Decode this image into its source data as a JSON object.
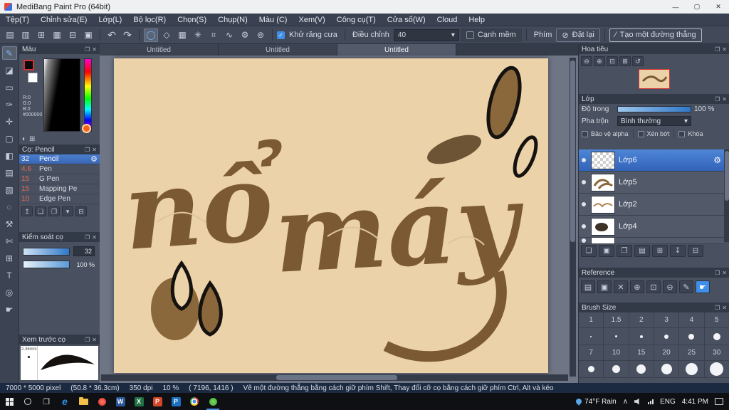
{
  "colors": {
    "accent": "#3f7fd6",
    "canvas": "#ecd2a9",
    "ink": "#7b5a33",
    "selection": "#3a66b4"
  },
  "titlebar": {
    "title": "MediBang Paint Pro (64bit)",
    "minimize": "—",
    "maximize": "▢",
    "close": "✕"
  },
  "menubar": {
    "items": [
      "Tệp(T)",
      "Chỉnh sửa(E)",
      "Lớp(L)",
      "Bộ lọc(R)",
      "Chọn(S)",
      "Chụp(N)",
      "Màu (C)",
      "Xem(V)",
      "Công cụ(T)",
      "Cửa sổ(W)",
      "Cloud",
      "Help"
    ]
  },
  "toolbar": {
    "anti_alias": "Khử răng cưa",
    "adjust_label": "Điều chỉnh",
    "adjust_value": "40",
    "soft_edge": "Cạnh mềm",
    "key_label": "Phím",
    "reset_label": "Đặt lại",
    "line_label": "Tạo một đường thẳng"
  },
  "tabs": {
    "items": [
      "Untitled",
      "Untitled",
      "Untitled"
    ],
    "active_index": 2
  },
  "canvas": {
    "word1": "nổ",
    "word2": "máy"
  },
  "color_panel": {
    "title": "Màu",
    "r": "R:0",
    "g": "G:0",
    "b": "B:0",
    "hex": "#000000"
  },
  "brush_panel": {
    "title": "Cọ: Pencil",
    "brushes": [
      {
        "size": "32",
        "name": "Pencil"
      },
      {
        "size": "4.6",
        "name": "Pen"
      },
      {
        "size": "15",
        "name": "G Pen"
      },
      {
        "size": "15",
        "name": "Mapping Pe"
      },
      {
        "size": "10",
        "name": "Edge Pen"
      }
    ]
  },
  "brush_control": {
    "title": "Kiểm soát cọ",
    "size_value": "32",
    "opacity_value": "100 %"
  },
  "brush_preview": {
    "title": "Xem trước cọ",
    "size_label": "2.36mm"
  },
  "navigator": {
    "title": "Hoa tiêu"
  },
  "layer_panel": {
    "title": "Lớp",
    "opacity_label": "Độ trong",
    "opacity_value": "100 %",
    "blend_label": "Pha trộn",
    "blend_value": "Bình thường",
    "alpha_lock_label": "Bảo vệ alpha",
    "clipping_label": "Xén bớt",
    "lock_label": "Khóa",
    "layers": [
      "Lớp6",
      "Lớp5",
      "Lớp2",
      "Lớp4"
    ]
  },
  "reference_panel": {
    "title": "Reference"
  },
  "brush_size_panel": {
    "title": "Brush Size",
    "row1": [
      "1",
      "1.5",
      "2",
      "3",
      "4",
      "5"
    ],
    "row2": [
      "7",
      "10",
      "15",
      "20",
      "25",
      "30"
    ]
  },
  "statusbar": {
    "dimensions": "7000 * 5000 pixel",
    "size_cm": "(50.8 * 36.3cm)",
    "dpi": "350 dpi",
    "zoom": "10 %",
    "coords": "( 7196, 1416 )",
    "hint": "Vẽ một đường thẳng bằng cách giữ phím Shift, Thay đổi cỡ cọ bằng cách giữ phím Ctrl, Alt và kéo"
  },
  "taskbar": {
    "weather": "74°F Rain",
    "language": "ENG",
    "time": "4:41 PM"
  }
}
